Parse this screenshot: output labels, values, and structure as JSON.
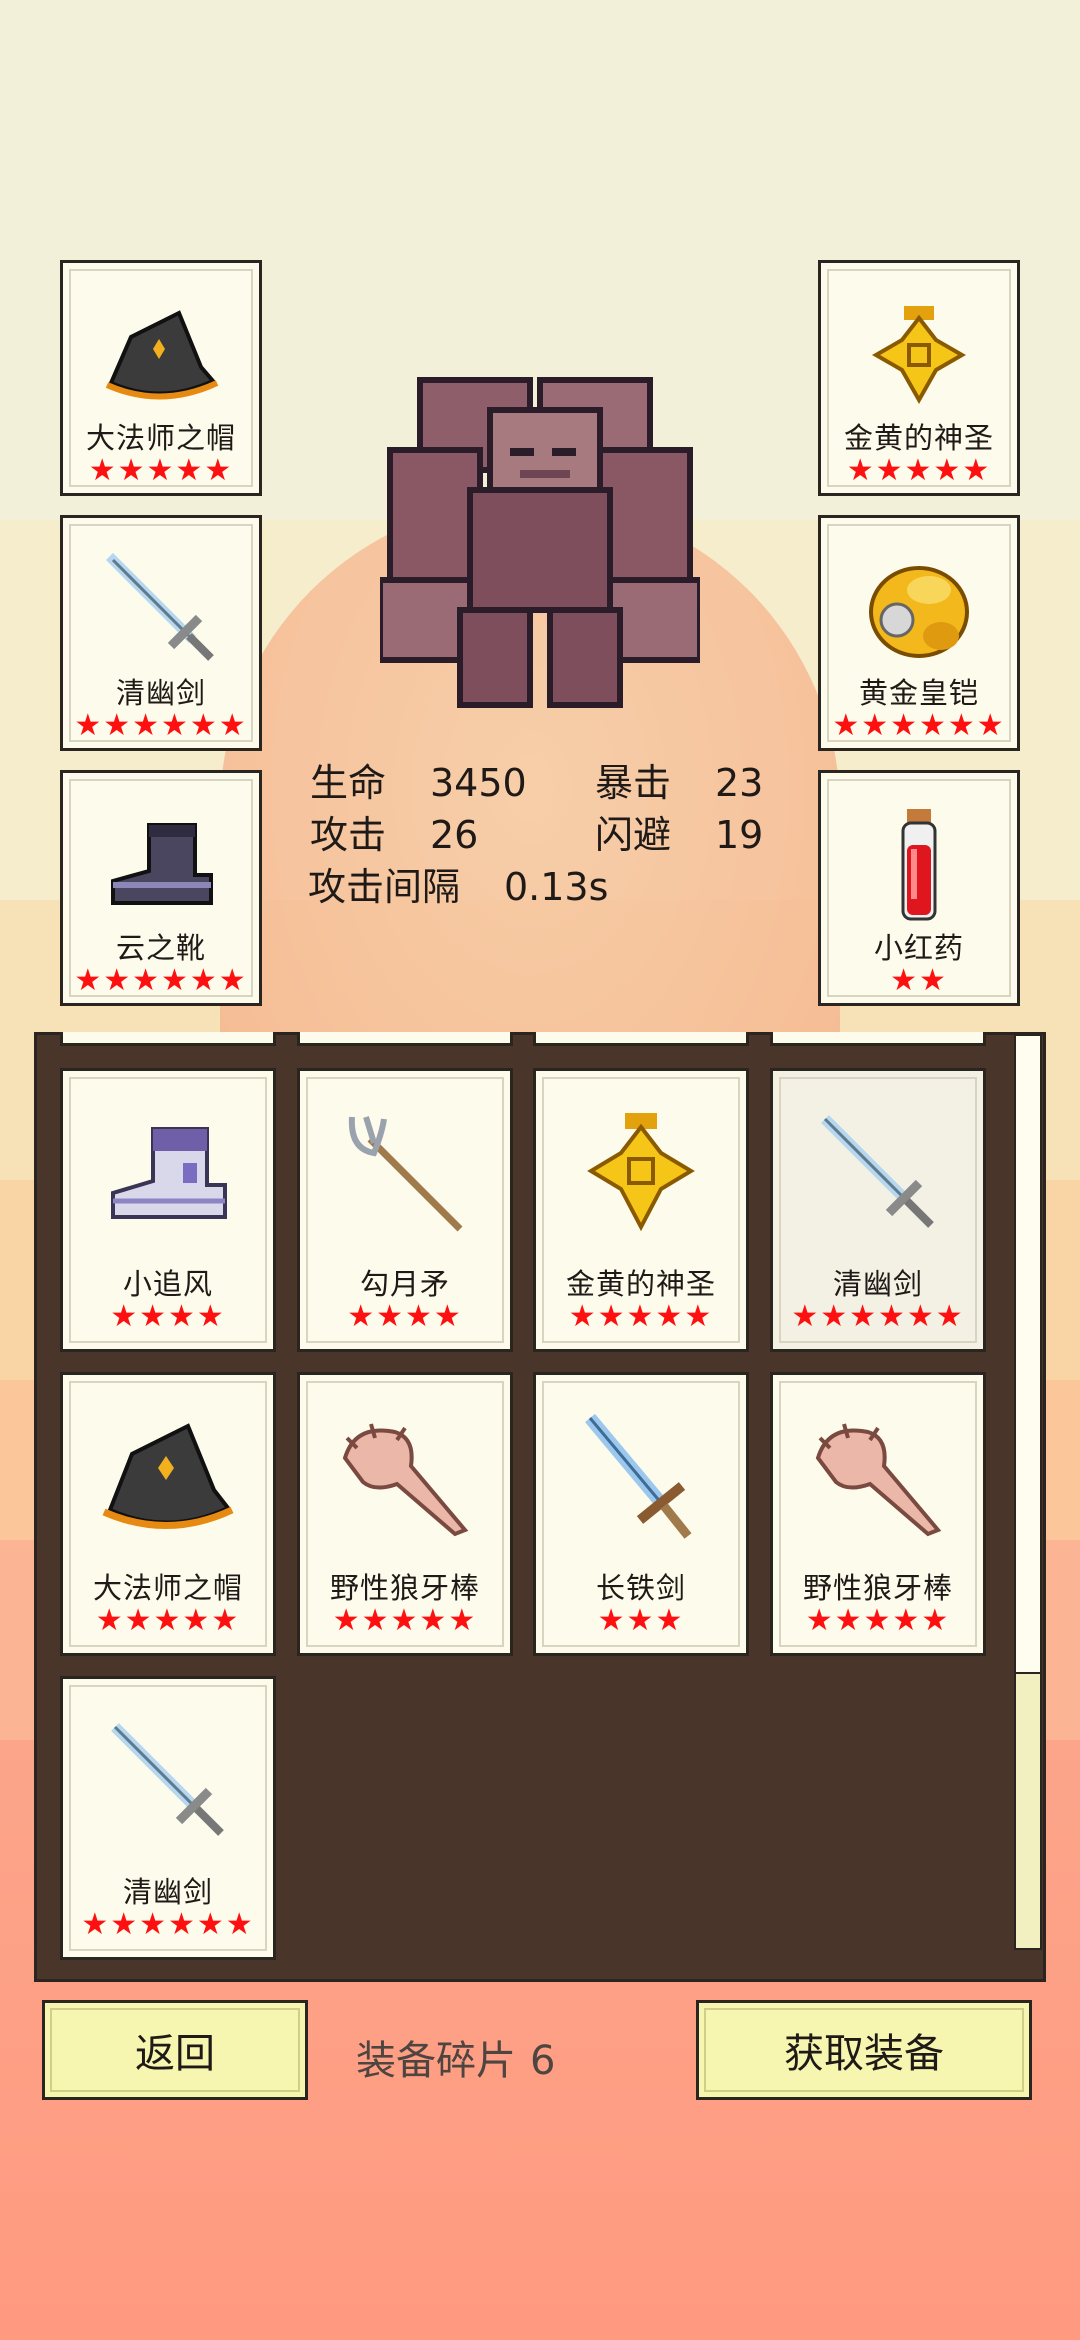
{
  "equipped": {
    "left": [
      {
        "name": "大法师之帽",
        "stars": "★★★★★",
        "icon": "wizard-hat-icon"
      },
      {
        "name": "清幽剑",
        "stars": "★★★★★★",
        "icon": "sword-icon"
      },
      {
        "name": "云之靴",
        "stars": "★★★★★★",
        "icon": "boot-icon"
      }
    ],
    "right": [
      {
        "name": "金黄的神圣",
        "stars": "★★★★★",
        "icon": "holy-cross-icon"
      },
      {
        "name": "黄金皇铠",
        "stars": "★★★★★★",
        "icon": "gold-armor-icon"
      },
      {
        "name": "小红药",
        "stars": "★★",
        "icon": "red-potion-icon"
      }
    ]
  },
  "hero": {
    "icon": "stone-golem-icon"
  },
  "stats": {
    "hp_label": "生命",
    "hp_value": "3450",
    "crit_label": "暴击",
    "crit_value": "23",
    "atk_label": "攻击",
    "atk_value": "26",
    "dodge_label": "闪避",
    "dodge_value": "19",
    "interval_label": "攻击间隔",
    "interval_value": "0.13s"
  },
  "inventory": [
    {
      "name": "小追风",
      "stars": "★★★★",
      "icon": "armored-boot-icon"
    },
    {
      "name": "勾月矛",
      "stars": "★★★★",
      "icon": "trident-icon"
    },
    {
      "name": "金黄的神圣",
      "stars": "★★★★★",
      "icon": "holy-cross-icon"
    },
    {
      "name": "清幽剑",
      "stars": "★★★★★★",
      "icon": "sword-icon",
      "selected": true
    },
    {
      "name": "大法师之帽",
      "stars": "★★★★★",
      "icon": "wizard-hat-icon"
    },
    {
      "name": "野性狼牙棒",
      "stars": "★★★★★",
      "icon": "spiked-club-icon"
    },
    {
      "name": "长铁剑",
      "stars": "★★★",
      "icon": "long-iron-sword-icon"
    },
    {
      "name": "野性狼牙棒",
      "stars": "★★★★★",
      "icon": "spiked-club-icon"
    },
    {
      "name": "清幽剑",
      "stars": "★★★★★★",
      "icon": "sword-icon"
    }
  ],
  "footer": {
    "back_label": "返回",
    "fragments_label": "装备碎片",
    "fragments_count": "6",
    "get_label": "获取装备"
  },
  "colors": {
    "star": "#ff1010",
    "panel": "#493529",
    "button": "#f6f6b0",
    "card": "#fdfcec"
  }
}
